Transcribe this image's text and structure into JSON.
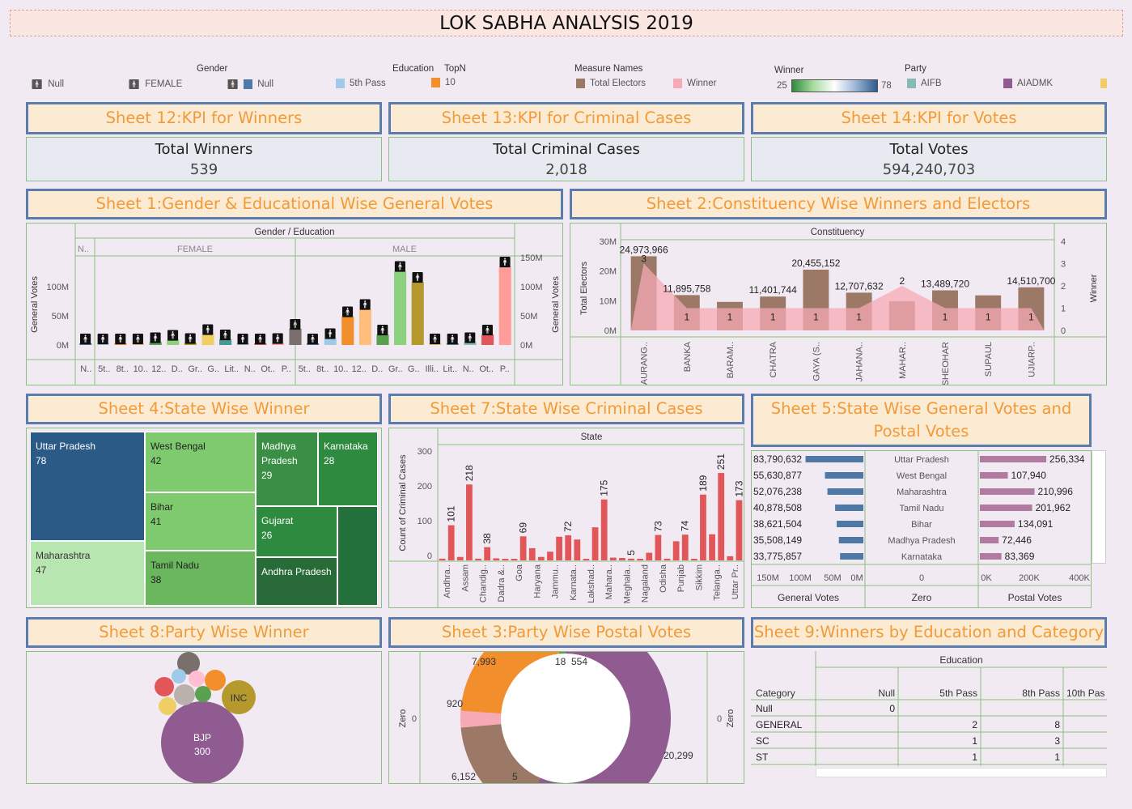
{
  "title": "LOK SABHA ANALYSIS 2019",
  "legends": {
    "gender": {
      "title": "Gender",
      "items": [
        "Null",
        "FEMALE",
        "Null"
      ]
    },
    "education": {
      "title": "Education",
      "items": [
        "5th Pass"
      ]
    },
    "topn": {
      "title": "TopN",
      "value": "10"
    },
    "measure": {
      "title": "Measure Names",
      "items": [
        "Total Electors",
        "Winner"
      ]
    },
    "winner": {
      "title": "Winner",
      "min": "25",
      "max": "78"
    },
    "party": {
      "title": "Party",
      "items": [
        "AIFB",
        "AIADMK"
      ]
    }
  },
  "kpis": [
    {
      "header": "Sheet 12:KPI for Winners",
      "label": "Total Winners",
      "value": "539"
    },
    {
      "header": "Sheet 13:KPI for Criminal Cases",
      "label": "Total Criminal Cases",
      "value": "2,018"
    },
    {
      "header": "Sheet 14:KPI for Votes",
      "label": "Total Votes",
      "value": "594,240,703"
    }
  ],
  "headers": {
    "s1": "Sheet 1:Gender & Educational Wise General Votes",
    "s2": "Sheet 2:Constituency Wise Winners and Electors",
    "s4": "Sheet 4:State Wise Winner",
    "s7": "Sheet 7:State Wise Criminal Cases",
    "s5": "Sheet 5:State Wise General Votes and Postal Votes",
    "s8": "Sheet 8:Party Wise Winner",
    "s3": "Sheet 3:Party Wise Postal Votes",
    "s9": "Sheet 9:Winners by Education and Category"
  },
  "s1": {
    "header_row": "Gender / Education",
    "groups": [
      "N..",
      "FEMALE",
      "MALE"
    ],
    "ylabel": "General Votes",
    "yticks": [
      "0M",
      "50M",
      "100M"
    ],
    "yticks_right": [
      "0M",
      "50M",
      "100M",
      "150M"
    ],
    "xlabels": [
      "N..",
      "5t..",
      "8t..",
      "10..",
      "12..",
      "D..",
      "Gr..",
      "G..",
      "Lit..",
      "N..",
      "Ot..",
      "P..",
      "5t..",
      "8t..",
      "10..",
      "12..",
      "D..",
      "Gr..",
      "G..",
      "Illi..",
      "Lit..",
      "N..",
      "Ot..",
      "P.."
    ]
  },
  "s2": {
    "header_row": "Constituency",
    "ylabel": "Total Electors",
    "ylabel_right": "Winner",
    "yticks": [
      "0M",
      "10M",
      "20M",
      "30M"
    ],
    "yticks_right": [
      "0",
      "1",
      "2",
      "3",
      "4"
    ],
    "bar_labels": [
      "24,973,966",
      "11,895,758",
      "",
      "11,401,744",
      "20,455,152",
      "12,707,632",
      "",
      "13,489,720",
      "",
      "14,510,700"
    ],
    "winner_labels": [
      "3",
      "1",
      "1",
      "1",
      "1",
      "1",
      "2",
      "1",
      "1",
      "1"
    ]
  },
  "s4": {
    "cells": [
      {
        "name": "Uttar Pradesh",
        "value": "78"
      },
      {
        "name": "West Bengal",
        "value": "42"
      },
      {
        "name": "Madhya Pradesh",
        "value": "29"
      },
      {
        "name": "Karnataka",
        "value": "28"
      },
      {
        "name": "Bihar",
        "value": "41"
      },
      {
        "name": "Gujarat",
        "value": "26"
      },
      {
        "name": "Maharashtra",
        "value": "47"
      },
      {
        "name": "Tamil Nadu",
        "value": "38"
      },
      {
        "name": "Andhra Pradesh",
        "value": ""
      }
    ]
  },
  "s7": {
    "header_row": "State",
    "ylabel": "Count of Criminal Cases",
    "yticks": [
      "0",
      "100",
      "200",
      "300"
    ],
    "xlabels": [
      "Andhra..",
      "Assam",
      "Chandig..",
      "Dadra &..",
      "Goa",
      "Haryana",
      "Jammu..",
      "Karnata..",
      "Lakshad..",
      "Mahara..",
      "Meghala..",
      "Nagaland",
      "Odisha",
      "Punjab",
      "Sikkim",
      "Telanga..",
      "Uttar Pr.."
    ]
  },
  "s5": {
    "left_axis": [
      "150M",
      "100M",
      "50M",
      "0M"
    ],
    "mid_axis": [
      "0"
    ],
    "right_axis": [
      "0K",
      "200K",
      "400K"
    ],
    "left_title": "General Votes",
    "mid_title": "Zero",
    "right_title": "Postal Votes"
  },
  "s8": {
    "bubbles": [
      {
        "label": "BJP",
        "value": "300"
      },
      {
        "label": "INC",
        "value": ""
      }
    ]
  },
  "s3": {
    "axis_label": "Zero",
    "zero": "0",
    "labels": [
      "7,993",
      "18",
      "554",
      "920",
      "20,299",
      "6,152",
      "5"
    ]
  },
  "s9": {
    "header_row": "Education",
    "row_header": "Category",
    "columns": [
      "Null",
      "5th Pass",
      "8th Pass",
      "10th Pas"
    ],
    "rows": [
      {
        "name": "Null",
        "values": [
          "0",
          "",
          "",
          ""
        ]
      },
      {
        "name": "GENERAL",
        "values": [
          "",
          "2",
          "8",
          ""
        ]
      },
      {
        "name": "SC",
        "values": [
          "",
          "1",
          "3",
          ""
        ]
      },
      {
        "name": "ST",
        "values": [
          "",
          "1",
          "1",
          ""
        ]
      }
    ]
  },
  "chart_data": [
    {
      "type": "bar",
      "title": "Sheet 1:Gender & Educational Wise General Votes",
      "ylabel": "General Votes",
      "ylim": [
        0,
        150000000
      ],
      "categories": [
        "N..",
        "5t..",
        "8t..",
        "10..",
        "12..",
        "D..",
        "Gr..",
        "G..",
        "Lit..",
        "N..",
        "Ot..",
        "P..",
        "5t..",
        "8t..",
        "10..",
        "12..",
        "D..",
        "Gr..",
        "G..",
        "Illi..",
        "Lit..",
        "N..",
        "Ot..",
        "P.."
      ],
      "values": [
        1500000,
        1200000,
        1500000,
        2500000,
        5000000,
        9000000,
        3500000,
        19000000,
        10000000,
        1500000,
        1000000,
        3500000,
        28000000,
        2500000,
        12000000,
        49000000,
        62000000,
        18000000,
        127000000,
        108000000,
        1500000,
        1500000,
        5000000,
        18000000,
        135000000
      ],
      "colors": [
        "#4e79a7",
        "#a0cbe8",
        "#f28e2b",
        "#ffbe7d",
        "#59a14f",
        "#8cd17d",
        "#b6992d",
        "#f1ce63",
        "#499894",
        "#86bcb6",
        "#e15759",
        "#ff9d9a",
        "#79706e"
      ]
    },
    {
      "type": "bar",
      "title": "Sheet 2:Constituency Wise Winners and Electors",
      "categories": [
        "AURANG..",
        "BANKA",
        "BARAM..",
        "CHATRA",
        "GAYA (S..",
        "JAHANA..",
        "MAHAR..",
        "SHEOHAR",
        "SUPAUL",
        "UJIARP.."
      ],
      "series": [
        {
          "name": "Total Electors",
          "values": [
            24973966,
            11895758,
            9600000,
            11401744,
            20455152,
            12707632,
            9800000,
            13489720,
            11800000,
            14510700
          ]
        },
        {
          "name": "Winner",
          "values": [
            3,
            1,
            1,
            1,
            1,
            1,
            2,
            1,
            1,
            1
          ]
        }
      ],
      "ylim": [
        0,
        30000000
      ],
      "ylim_right": [
        0,
        4
      ]
    },
    {
      "type": "bar",
      "title": "Sheet 7:State Wise Criminal Cases",
      "ylabel": "Count of Criminal Cases",
      "ylim": [
        0,
        300
      ],
      "values": [
        5,
        101,
        10,
        218,
        5,
        38,
        6,
        2,
        3,
        69,
        35,
        10,
        25,
        68,
        72,
        60,
        2,
        95,
        175,
        8,
        7,
        5,
        2,
        22,
        73,
        5,
        55,
        74,
        3,
        189,
        75,
        251,
        12,
        173
      ],
      "value_labels": {
        "1": "101",
        "3": "218",
        "5": "38",
        "9": "69",
        "14": "72",
        "18": "175",
        "21": "5",
        "24": "73",
        "27": "74",
        "29": "189",
        "31": "251",
        "33": "173"
      }
    },
    {
      "type": "bar",
      "title": "Sheet 5:State Wise General Votes and Postal Votes",
      "categories": [
        "Uttar Pradesh",
        "West Bengal",
        "Maharashtra",
        "Tamil Nadu",
        "Bihar",
        "Madhya Pradesh",
        "Karnataka"
      ],
      "series": [
        {
          "name": "General Votes",
          "values": [
            83790632,
            55630877,
            52076238,
            40878508,
            38621504,
            35508149,
            33775857
          ],
          "labels": [
            "83,790,632",
            "55,630,877",
            "52,076,238",
            "40,878,508",
            "38,621,504",
            "35,508,149",
            "33,775,857"
          ]
        },
        {
          "name": "Postal Votes",
          "values": [
            256334,
            107940,
            210996,
            201962,
            134091,
            72446,
            83369
          ],
          "labels": [
            "256,334",
            "107,940",
            "210,996",
            "201,962",
            "134,091",
            "72,446",
            "83,369"
          ]
        }
      ]
    },
    {
      "type": "pie",
      "title": "Sheet 3:Party Wise Postal Votes",
      "values": [
        20299,
        6152,
        920,
        7993,
        554,
        18,
        5
      ]
    }
  ]
}
